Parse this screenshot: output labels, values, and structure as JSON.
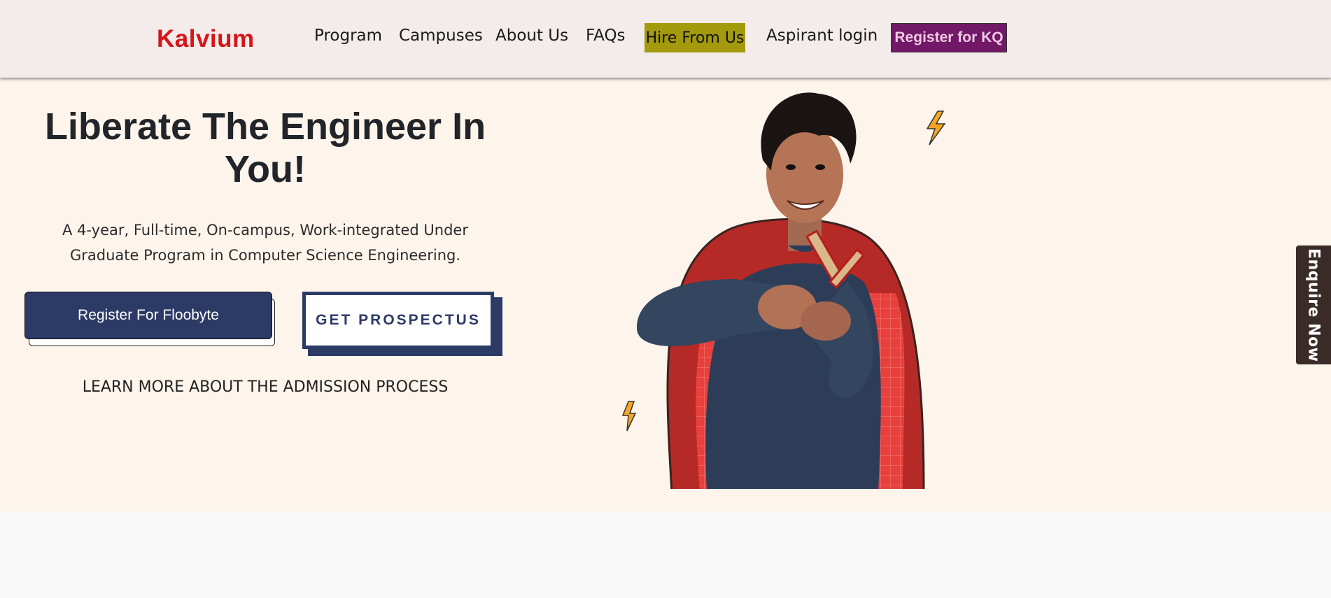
{
  "brand": {
    "logo_text": "Kalvium",
    "logo_color": "#d6151a"
  },
  "nav": {
    "items": [
      {
        "label": "Program"
      },
      {
        "label": "Campuses"
      },
      {
        "label": "About Us"
      },
      {
        "label": "FAQs"
      }
    ],
    "hire_label": "Hire From Us",
    "aspirant_label": "Aspirant login",
    "kq_label": "Register for KQ"
  },
  "hero": {
    "title": "Liberate The Engineer In You!",
    "subtitle": "A 4-year, Full-time, On-campus, Work-integrated Under Graduate Program in Computer Science Engineering.",
    "register_label": "Register For Floobyte",
    "prospectus_label": "GET PROSPECTUS",
    "learn_more_label": "LEARN MORE ABOUT THE ADMISSION PROCESS"
  },
  "enquire": {
    "label": "Enquire Now"
  },
  "colors": {
    "header_bg": "#f4ecea",
    "hero_bg": "#fdf4ec",
    "primary": "#2c3a66",
    "hire_bg": "#a39a0e",
    "kq_bg": "#711866",
    "enquire_bg": "#3a2b29",
    "cape": "#b52a26"
  },
  "illustration": {
    "icon": "student-with-cape-illustration"
  }
}
